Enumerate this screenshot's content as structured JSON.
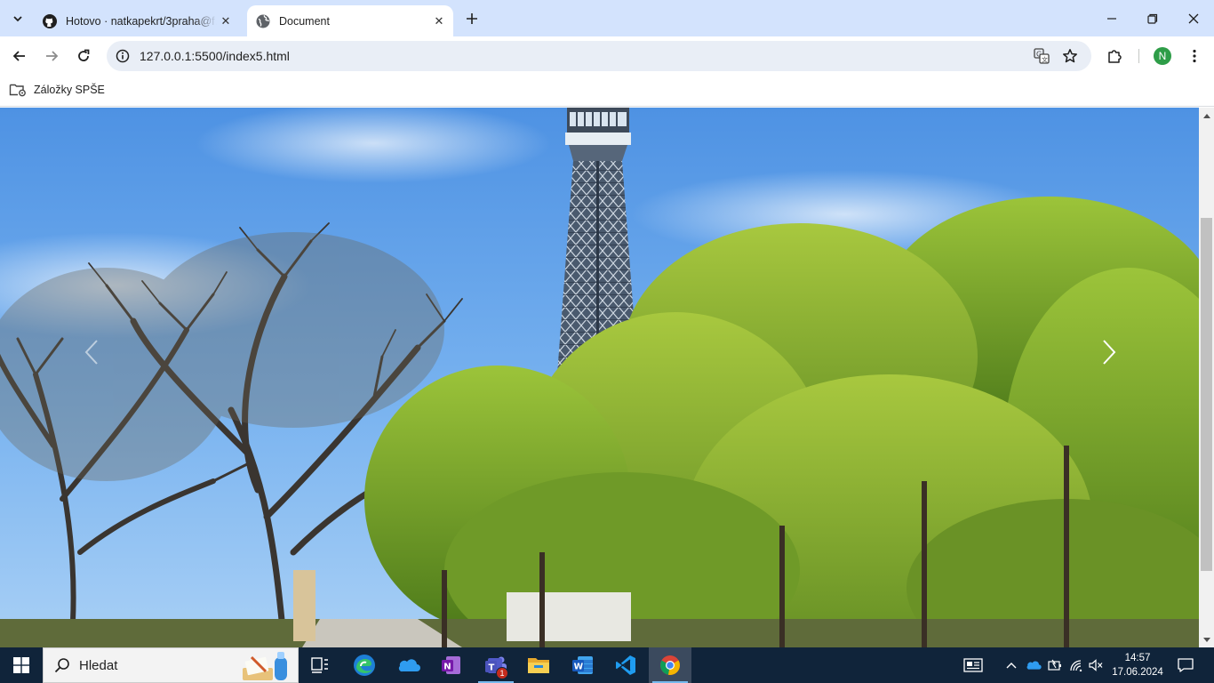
{
  "browser": {
    "tabs": [
      {
        "title": "Hotovo · natkapekrt/3praha@f…",
        "active": false,
        "icon": "github-icon"
      },
      {
        "title": "Document",
        "active": true,
        "icon": "globe-icon"
      }
    ],
    "url": "127.0.0.1:5500/index5.html",
    "profile_initial": "N",
    "bookmarks": [
      {
        "label": "Záložky SPŠE",
        "icon": "managed-bookmarks-folder-icon"
      }
    ]
  },
  "page": {
    "carousel": {
      "image_description_icon": "petrin-tower-photo",
      "prev_icon": "chevron-left-icon",
      "next_icon": "chevron-right-icon"
    }
  },
  "taskbar": {
    "search_placeholder": "Hledat",
    "apps": [
      {
        "name": "task-view",
        "icon": "task-view-icon"
      },
      {
        "name": "edge",
        "icon": "edge-icon"
      },
      {
        "name": "onedrive",
        "icon": "onedrive-icon"
      },
      {
        "name": "onenote",
        "icon": "onenote-icon"
      },
      {
        "name": "teams",
        "icon": "teams-icon",
        "badge": "1"
      },
      {
        "name": "file-explorer",
        "icon": "folder-icon"
      },
      {
        "name": "word",
        "icon": "word-icon"
      },
      {
        "name": "vscode",
        "icon": "vscode-icon"
      },
      {
        "name": "chrome",
        "icon": "chrome-icon"
      }
    ],
    "time": "14:57",
    "date": "17.06.2024"
  },
  "colors": {
    "tabstrip": "#d3e3fd",
    "taskbar": "#10243a",
    "sky": "#5a9be6",
    "foliage": "#8bb52c"
  }
}
